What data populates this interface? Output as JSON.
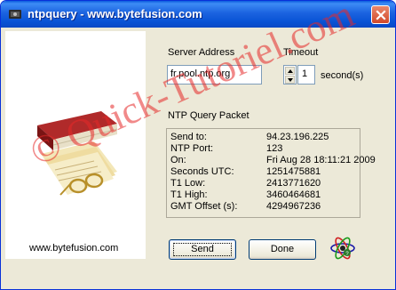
{
  "window": {
    "title": "ntpquery - www.bytefusion.com",
    "icon": "ntpquery-app-icon",
    "close_icon": "close-icon"
  },
  "sidebar": {
    "image": "books-and-glasses-illustration",
    "link": "www.bytefusion.com"
  },
  "server": {
    "label": "Server Address",
    "value": "fr.pool.ntp.org"
  },
  "timeout": {
    "label": "Timeout",
    "value": "1",
    "unit": "second(s)"
  },
  "packet": {
    "label": "NTP Query Packet",
    "rows": [
      {
        "key": "Send to:",
        "value": "94.23.196.225"
      },
      {
        "key": "NTP Port:",
        "value": "123"
      },
      {
        "key": "On:",
        "value": "Fri Aug 28 18:11:21 2009"
      },
      {
        "key": "Seconds UTC:",
        "value": "1251475881"
      },
      {
        "key": "T1 Low:",
        "value": "2413771620"
      },
      {
        "key": "T1 High:",
        "value": "3460464681"
      },
      {
        "key": "GMT Offset (s):",
        "value": "4294967236"
      }
    ]
  },
  "buttons": {
    "send": "Send",
    "done": "Done"
  },
  "about_icon": "atom-icon",
  "watermark": "© Quick-Tutoriel.com",
  "colors": {
    "titlebar": "#0a5bde",
    "dialog_bg": "#ece9d8",
    "watermark": "#e62828"
  }
}
